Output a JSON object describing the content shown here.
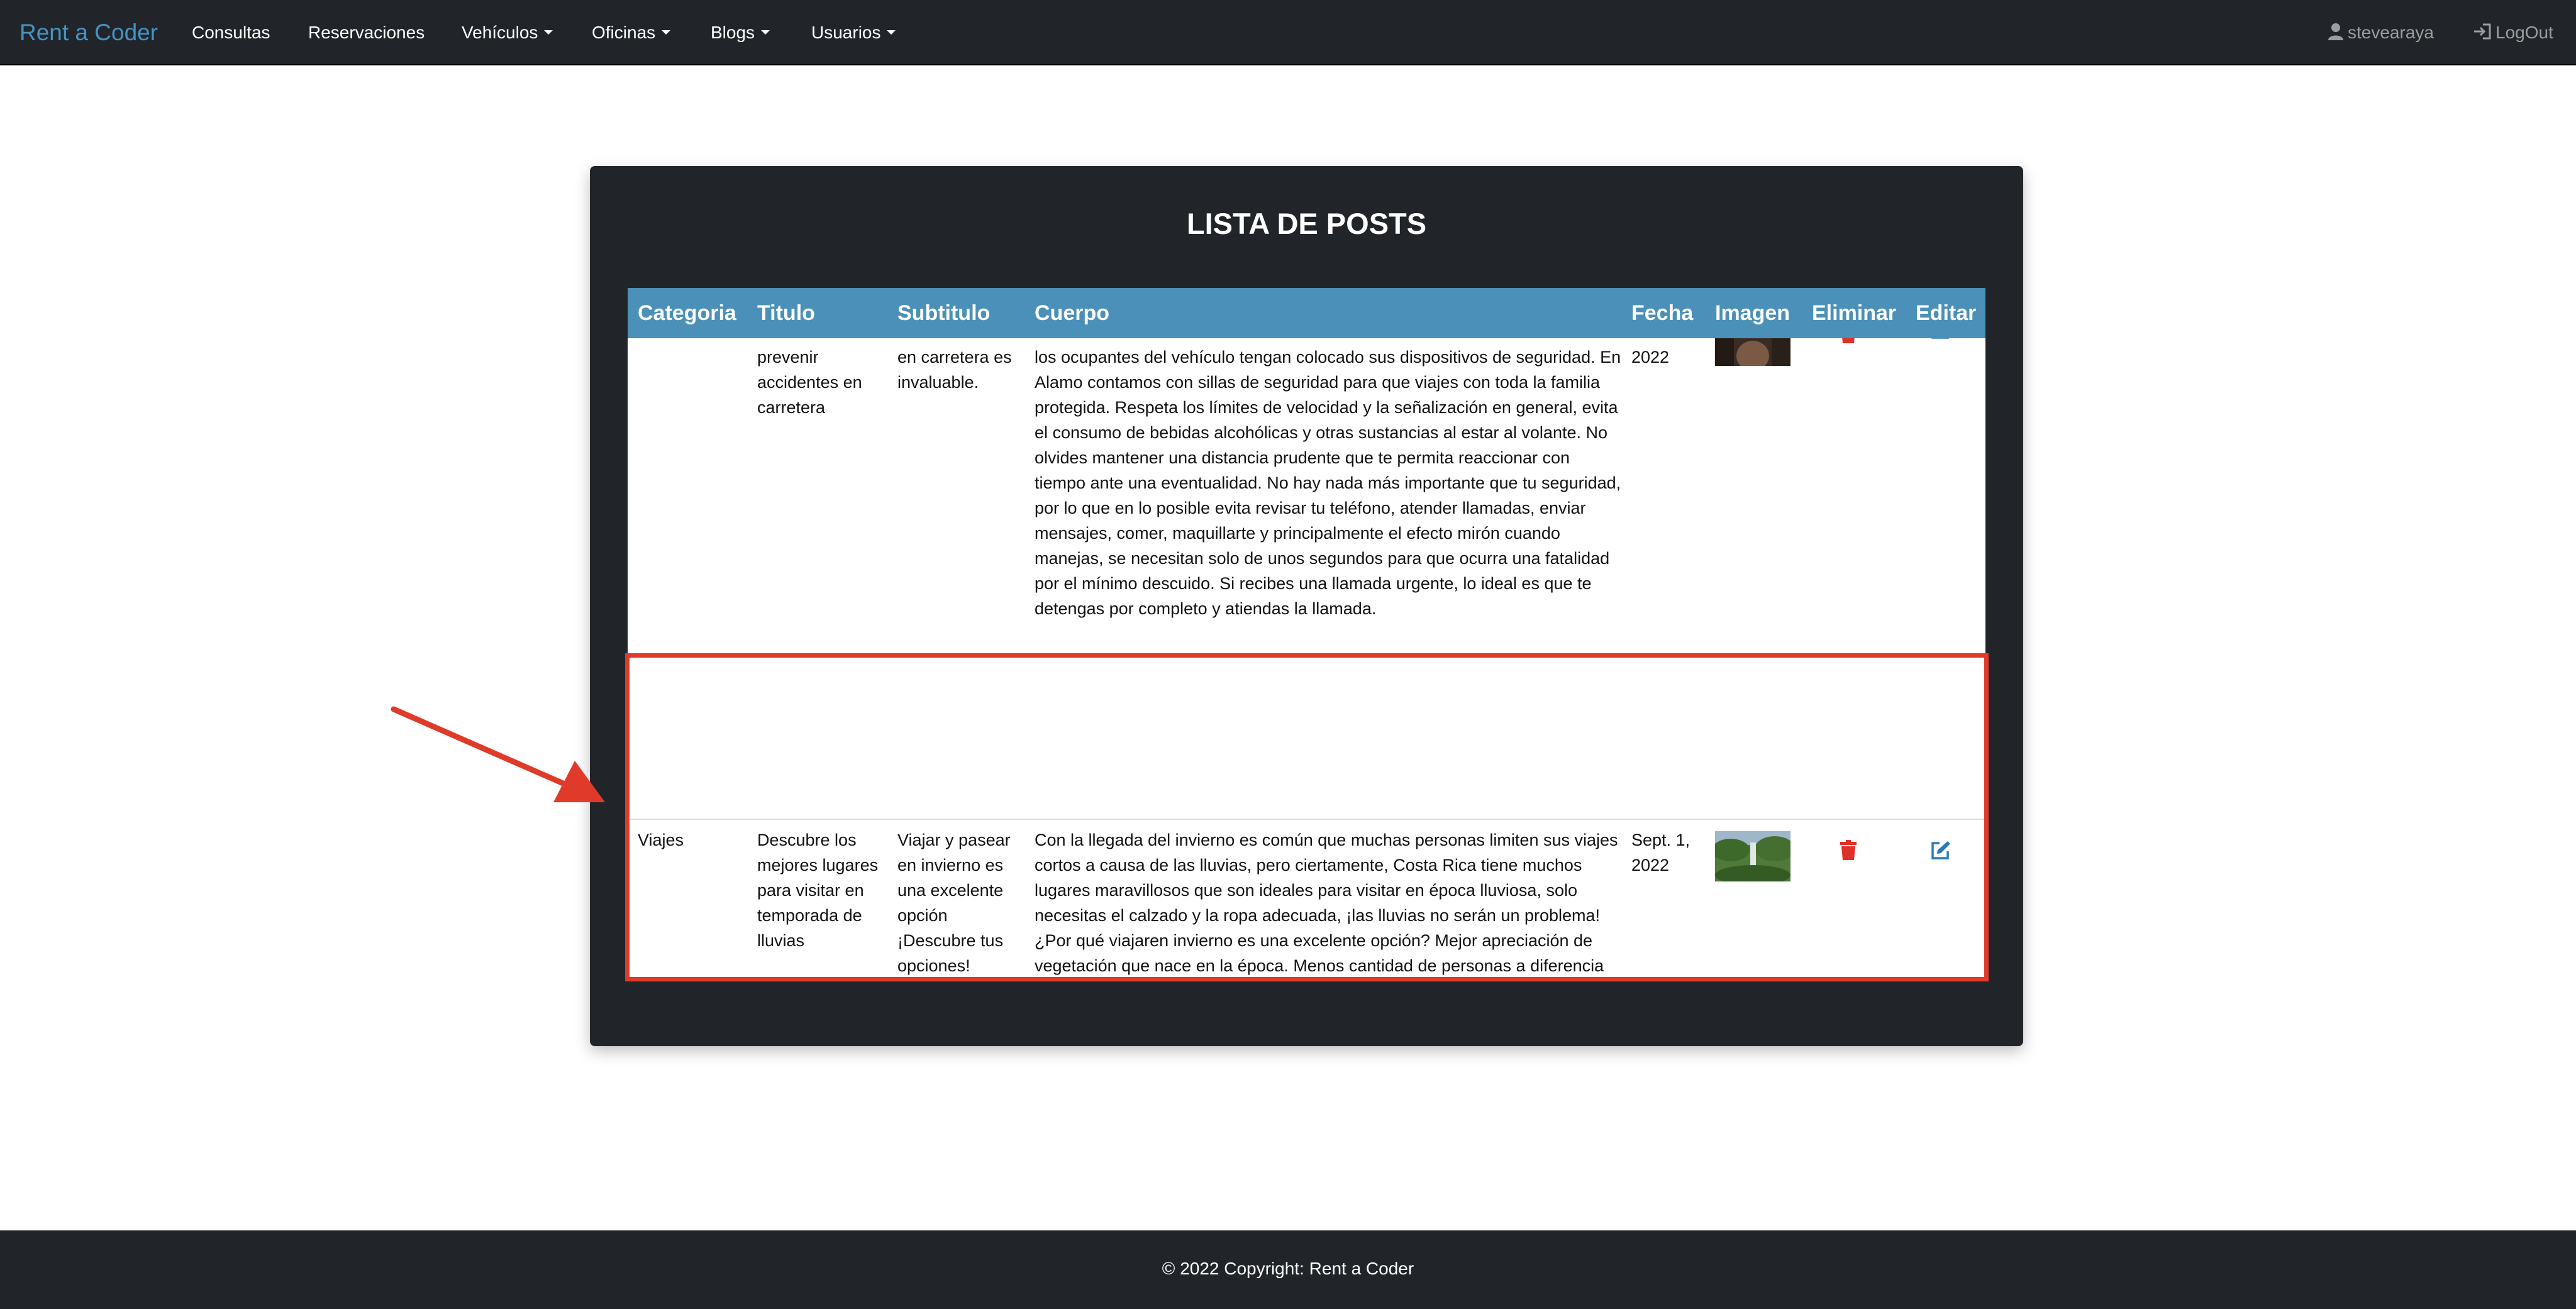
{
  "navbar": {
    "brand": "Rent a Coder",
    "items": [
      {
        "label": "Consultas"
      },
      {
        "label": "Reservaciones"
      },
      {
        "label": "Vehículos"
      },
      {
        "label": "Oficinas"
      },
      {
        "label": "Blogs"
      },
      {
        "label": "Usuarios"
      }
    ],
    "user": "stevearaya",
    "logout": "LogOut"
  },
  "panel": {
    "title": "LISTA DE POSTS",
    "columns": [
      "Categoria",
      "Titulo",
      "Subtitulo",
      "Cuerpo",
      "Fecha",
      "Imagen",
      "Eliminar",
      "Editar"
    ],
    "rows": [
      {
        "categoria": "",
        "titulo": "prevenir accidentes en carretera",
        "subtitulo": "en carretera es invaluable.",
        "cuerpo": "los ocupantes del vehículo tengan colocado sus dispositivos de seguridad. En Alamo contamos con sillas de seguridad para que viajes con toda la familia protegida. Respeta los límites de velocidad y la señalización en general, evita el consumo de bebidas alcohólicas y otras sustancias al estar al volante. No olvides mantener una distancia prudente que te permita reaccionar con tiempo ante una eventualidad. No hay nada más importante que tu seguridad, por lo que en lo posible evita revisar tu teléfono, atender llamadas, enviar mensajes, comer, maquillarte y principalmente el efecto mirón cuando manejas, se necesitan solo de unos segundos para que ocurra una fatalidad por el mínimo descuido. Si recibes una llamada urgente, lo ideal es que te detengas por completo y atiendas la llamada.",
        "fecha": "2022"
      },
      {
        "categoria": "Viajes",
        "titulo": "Descubre los mejores lugares para visitar en temporada de lluvias",
        "subtitulo": "Viajar y pasear en invierno es una excelente opción ¡Descubre tus opciones!",
        "cuerpo": "Con la llegada del invierno es común que muchas personas limiten sus viajes cortos a causa de las lluvias, pero ciertamente, Costa Rica tiene muchos lugares maravillosos que son ideales para visitar en época lluviosa, solo necesitas el calzado y la ropa adecuada, ¡las lluvias no serán un problema! ¿Por qué viajaren invierno es una excelente opción? Mejor apreciación de vegetación que nace en la época. Menos cantidad de personas a diferencia de viajar en verano. Encuentras tarifas bajas en tours y hospedajes durante la época de lluvias. Más posibilidad de avistamiento de diferentes especies por la baja visitación de turistas. Te dejamos ideas de actividades bajo techo que puedes realizar en invierno: Visitas a Museos. Realizar tours gastronómicos. Disfrutar de obras en los diferentes teatros. Tarde de películas en los diferentes cines del país.",
        "fecha": "Sept. 1, 2022"
      }
    ]
  },
  "footer": {
    "text": "© 2022 Copyright: Rent a Coder"
  },
  "colors": {
    "navbar_bg": "#212529",
    "brand": "#4593c4",
    "table_header": "#4a90b8",
    "delete_icon": "#e0302a",
    "edit_icon": "#2a7ab8",
    "highlight": "#e03a2a"
  }
}
